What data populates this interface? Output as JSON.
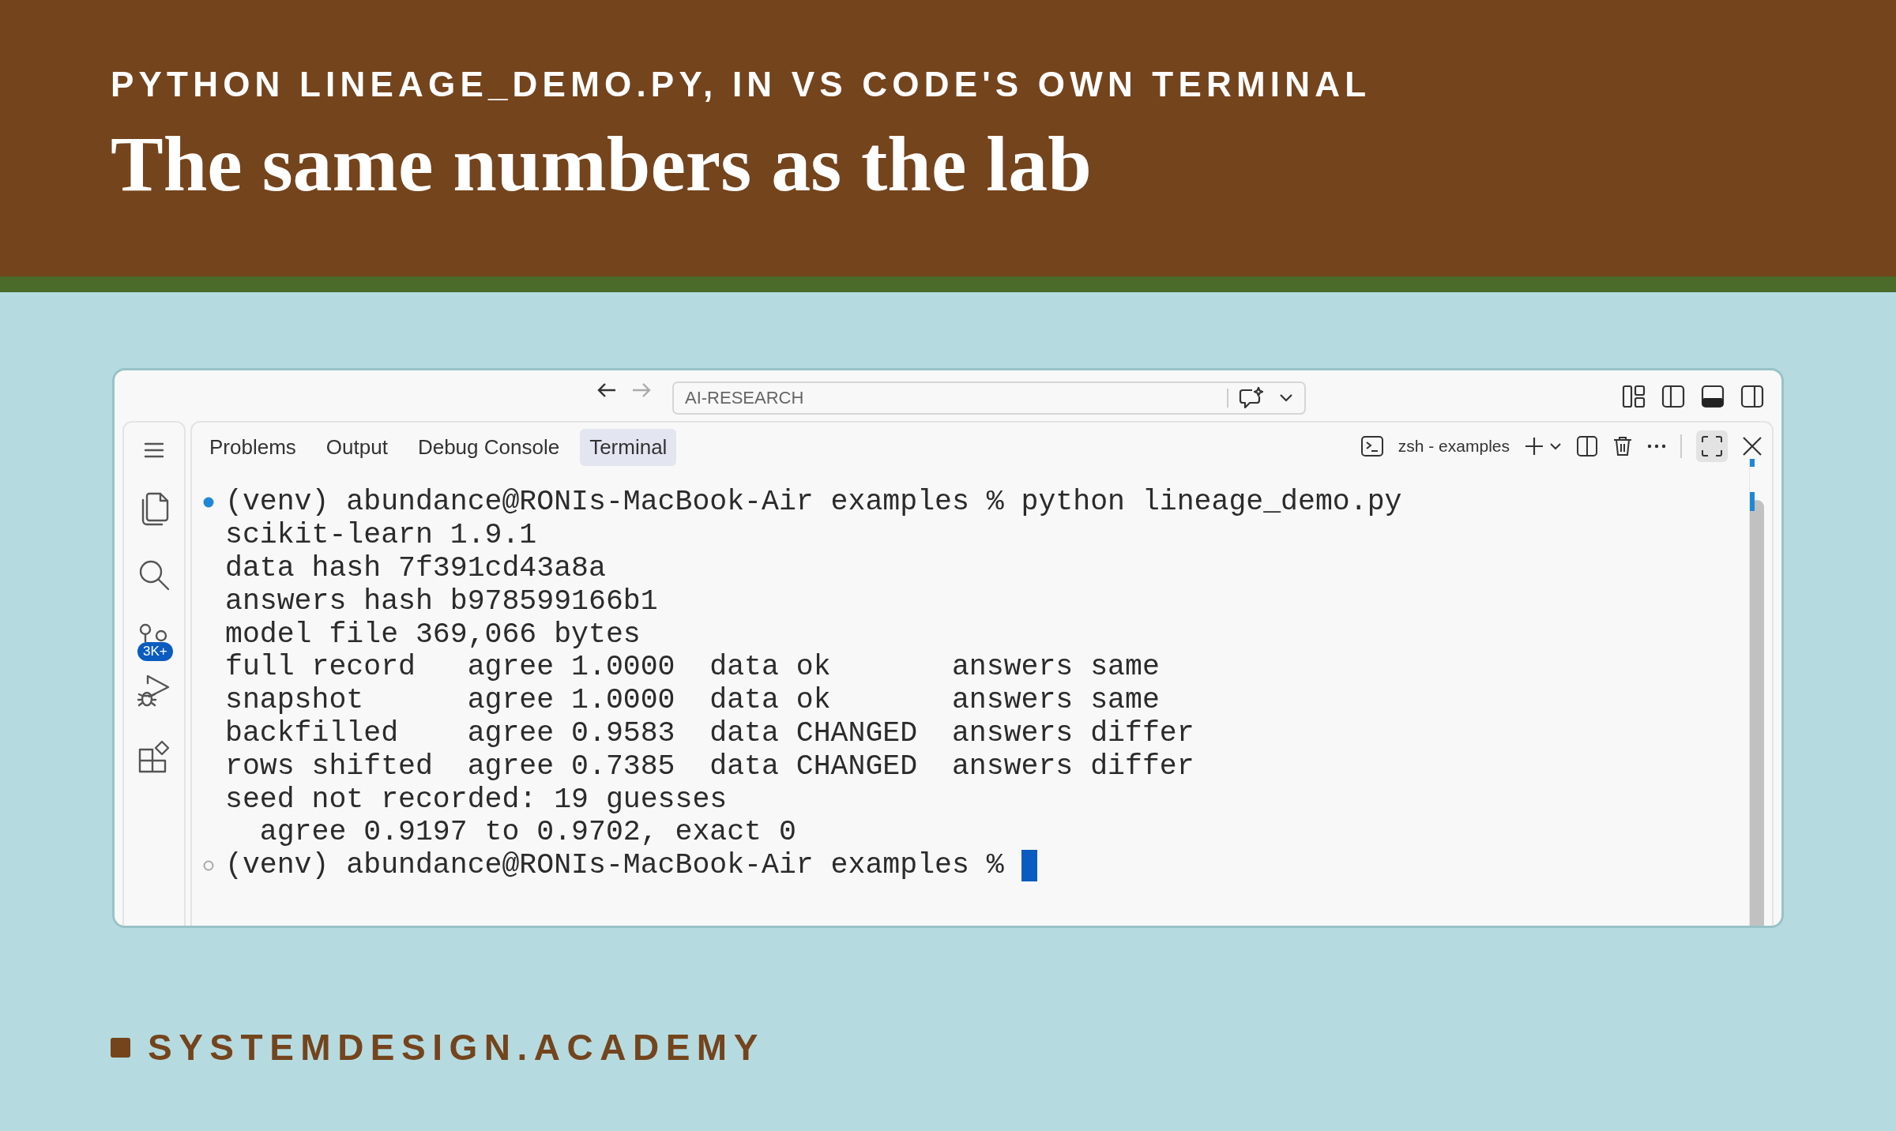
{
  "header": {
    "kicker": "PYTHON LINEAGE_DEMO.PY, IN VS CODE'S OWN TERMINAL",
    "title": "The same numbers as the lab"
  },
  "window": {
    "address": "AI-RESEARCH",
    "activity_bar": [
      {
        "kind": "menu"
      },
      {
        "kind": "explorer"
      },
      {
        "kind": "search"
      },
      {
        "kind": "source-control",
        "badge": "3K+"
      },
      {
        "kind": "run-debug"
      },
      {
        "kind": "extensions"
      }
    ],
    "tabs": [
      {
        "label": "Problems",
        "selected": false
      },
      {
        "label": "Output",
        "selected": false
      },
      {
        "label": "Debug Console",
        "selected": false
      },
      {
        "label": "Terminal",
        "selected": true
      }
    ],
    "terminal_name": "zsh - examples",
    "lines": [
      {
        "command_done": true,
        "text": "(venv) abundance@RONIs-MacBook-Air examples % python lineage_demo.py"
      },
      {
        "text": "scikit-learn 1.9.1"
      },
      {
        "text": "data hash 7f391cd43a8a"
      },
      {
        "text": "answers hash b978599166b1"
      },
      {
        "text": "model file 369,066 bytes"
      },
      {
        "text": "full record   agree 1.0000  data ok       answers same"
      },
      {
        "text": "snapshot      agree 1.0000  data ok       answers same"
      },
      {
        "text": "backfilled    agree 0.9583  data CHANGED  answers differ"
      },
      {
        "text": "rows shifted  agree 0.7385  data CHANGED  answers differ"
      },
      {
        "text": "seed not recorded: 19 guesses"
      },
      {
        "text": "  agree 0.9197 to 0.9702, exact 0"
      },
      {
        "command_done": false,
        "text": "(venv) abundance@RONIs-MacBook-Air examples % ",
        "cursor": true
      }
    ]
  },
  "footer": {
    "brand": "SYSTEMDESIGN.ACADEMY"
  }
}
